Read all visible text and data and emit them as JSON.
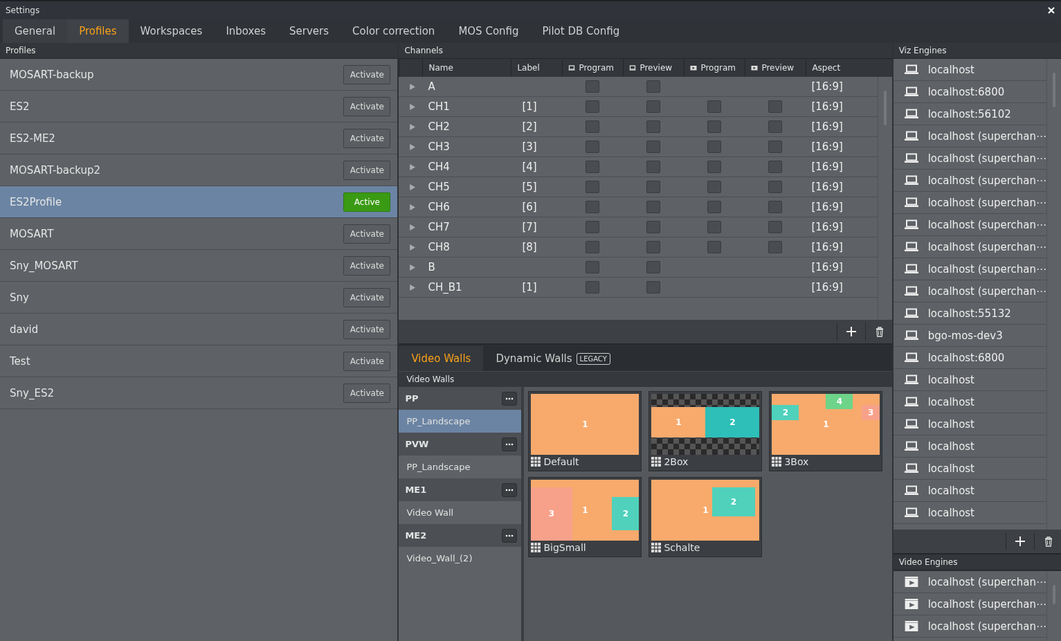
{
  "window": {
    "title": "Settings"
  },
  "tabs": [
    {
      "label": "General",
      "selected": false
    },
    {
      "label": "Profiles",
      "selected": true
    },
    {
      "label": "Workspaces",
      "selected": false
    },
    {
      "label": "Inboxes",
      "selected": false
    },
    {
      "label": "Servers",
      "selected": false
    },
    {
      "label": "Color correction",
      "selected": false
    },
    {
      "label": "MOS Config",
      "selected": false
    },
    {
      "label": "Pilot DB Config",
      "selected": false
    }
  ],
  "profiles": {
    "title": "Profiles",
    "items": [
      {
        "name": "MOSART-backup",
        "button": "Activate",
        "active": false,
        "selected": false
      },
      {
        "name": "ES2",
        "button": "Activate",
        "active": false,
        "selected": false
      },
      {
        "name": "ES2-ME2",
        "button": "Activate",
        "active": false,
        "selected": false
      },
      {
        "name": "MOSART-backup2",
        "button": "Activate",
        "active": false,
        "selected": false
      },
      {
        "name": "ES2Profile",
        "button": "Active",
        "active": true,
        "selected": true
      },
      {
        "name": "MOSART",
        "button": "Activate",
        "active": false,
        "selected": false
      },
      {
        "name": "Sny_MOSART",
        "button": "Activate",
        "active": false,
        "selected": false
      },
      {
        "name": "Sny",
        "button": "Activate",
        "active": false,
        "selected": false
      },
      {
        "name": "david",
        "button": "Activate",
        "active": false,
        "selected": false
      },
      {
        "name": "Test",
        "button": "Activate",
        "active": false,
        "selected": false
      },
      {
        "name": "Sny_ES2",
        "button": "Activate",
        "active": false,
        "selected": false
      }
    ]
  },
  "channels": {
    "title": "Channels",
    "columns": [
      {
        "label": "Name"
      },
      {
        "label": "Label"
      },
      {
        "label": "Program",
        "kind": "monitor"
      },
      {
        "label": "Preview",
        "kind": "monitor"
      },
      {
        "label": "Program",
        "kind": "film"
      },
      {
        "label": "Preview",
        "kind": "film"
      },
      {
        "label": "Aspect"
      }
    ],
    "rows": [
      {
        "name": "A",
        "expanded": false,
        "checks": [
          false,
          false
        ],
        "aspect": "[16:9]"
      },
      {
        "name": "CH1",
        "label": "[1]",
        "expanded": false,
        "checks": [
          false,
          false,
          false,
          false
        ],
        "aspect": "[16:9]"
      },
      {
        "name": "CH2",
        "label": "[2]",
        "expanded": false,
        "checks": [
          false,
          false,
          false,
          false
        ],
        "aspect": "[16:9]"
      },
      {
        "name": "CH3",
        "label": "[3]",
        "expanded": false,
        "checks": [
          false,
          false,
          false,
          false
        ],
        "aspect": "[16:9]"
      },
      {
        "name": "CH4",
        "label": "[4]",
        "expanded": false,
        "checks": [
          false,
          false,
          false,
          false
        ],
        "aspect": "[16:9]"
      },
      {
        "name": "CH5",
        "label": "[5]",
        "expanded": false,
        "checks": [
          false,
          false,
          false,
          false
        ],
        "aspect": "[16:9]"
      },
      {
        "name": "CH6",
        "label": "[6]",
        "expanded": false,
        "checks": [
          false,
          false,
          false,
          false
        ],
        "aspect": "[16:9]"
      },
      {
        "name": "CH7",
        "label": "[7]",
        "expanded": false,
        "checks": [
          false,
          false,
          false,
          false
        ],
        "aspect": "[16:9]"
      },
      {
        "name": "CH8",
        "label": "[8]",
        "expanded": false,
        "checks": [
          false,
          false,
          false,
          false
        ],
        "aspect": "[16:9]"
      },
      {
        "name": "B",
        "expanded": false,
        "checks": [
          false,
          false
        ],
        "aspect": "[16:9]"
      },
      {
        "name": "CH_B1",
        "label": "[1]",
        "expanded": false,
        "checks": [
          false,
          false
        ],
        "aspect": "[16:9]"
      }
    ]
  },
  "wall_tabs": [
    {
      "label": "Video Walls",
      "selected": true
    },
    {
      "label": "Dynamic Walls",
      "badge": "LEGACY",
      "selected": false
    }
  ],
  "video_walls": {
    "title": "Video Walls",
    "groups": [
      {
        "name": "PP",
        "items": [
          {
            "name": "PP_Landscape",
            "selected": true
          }
        ]
      },
      {
        "name": "PVW",
        "items": [
          {
            "name": "PP_Landscape",
            "selected": false
          }
        ]
      },
      {
        "name": "ME1",
        "items": [
          {
            "name": "Video Wall",
            "selected": false
          }
        ]
      },
      {
        "name": "ME2",
        "items": [
          {
            "name": "Video_Wall_(2)",
            "selected": false
          }
        ]
      }
    ],
    "layouts": [
      {
        "name": "Default",
        "kind": "default",
        "regions": [
          {
            "label": "1",
            "color": "#f7aa6c"
          }
        ]
      },
      {
        "name": "2Box",
        "kind": "twobox",
        "regions": [
          {
            "label": "1",
            "color": "#f7aa6c"
          },
          {
            "label": "2",
            "color": "#2dbfb8"
          }
        ]
      },
      {
        "name": "3Box",
        "kind": "threebox",
        "regions": [
          {
            "label": "4",
            "color": "#6dd48a"
          },
          {
            "label": "2",
            "color": "#4fd1bb"
          },
          {
            "label": "3",
            "color": "#f7a18a"
          },
          {
            "label": "1",
            "color": "#f7aa6c"
          }
        ]
      },
      {
        "name": "BigSmall",
        "kind": "bigsmall",
        "regions": [
          {
            "label": "3",
            "color": "#f7a18a"
          },
          {
            "label": "1",
            "color": "#f7aa6c"
          },
          {
            "label": "2",
            "color": "#4fd1bb"
          }
        ]
      },
      {
        "name": "Schalte",
        "kind": "schalte",
        "regions": [
          {
            "label": "1",
            "color": "#f7aa6c"
          },
          {
            "label": "2",
            "color": "#4fd1bb"
          }
        ]
      }
    ]
  },
  "viz_engines": {
    "title": "Viz Engines",
    "items": [
      "localhost",
      "localhost:6800",
      "localhost:56102",
      "localhost (superchan⋯",
      "localhost (superchan⋯",
      "localhost (superchan⋯",
      "localhost (superchan⋯",
      "localhost (superchan⋯",
      "localhost (superchan⋯",
      "localhost (superchan⋯",
      "localhost (superchan⋯",
      "localhost:55132",
      "bgo-mos-dev3",
      "localhost:6800",
      "localhost",
      "localhost",
      "localhost",
      "localhost",
      "localhost",
      "localhost",
      "localhost"
    ]
  },
  "video_engines": {
    "title": "Video Engines",
    "items": [
      "localhost (superchan⋯",
      "localhost (superchan⋯",
      "localhost (superchan⋯"
    ]
  }
}
